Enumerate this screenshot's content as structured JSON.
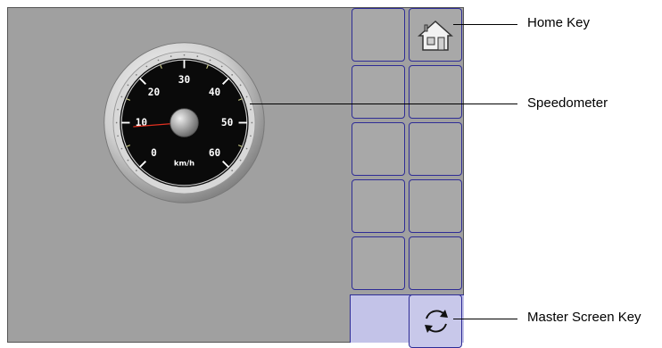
{
  "gauge": {
    "scale_labels": [
      "0",
      "10",
      "20",
      "30",
      "40",
      "50",
      "60"
    ],
    "unit": "km/h",
    "speed_value": 9
  },
  "softkeys": [
    {
      "row": 0,
      "col": 0,
      "icon": ""
    },
    {
      "row": 0,
      "col": 1,
      "icon": "home-icon"
    },
    {
      "row": 1,
      "col": 0,
      "icon": ""
    },
    {
      "row": 1,
      "col": 1,
      "icon": ""
    },
    {
      "row": 2,
      "col": 0,
      "icon": ""
    },
    {
      "row": 2,
      "col": 1,
      "icon": ""
    },
    {
      "row": 3,
      "col": 0,
      "icon": ""
    },
    {
      "row": 3,
      "col": 1,
      "icon": ""
    },
    {
      "row": 4,
      "col": 0,
      "icon": ""
    },
    {
      "row": 4,
      "col": 1,
      "icon": ""
    },
    {
      "row": 5,
      "col": 1,
      "icon": "refresh-icon"
    }
  ],
  "callouts": {
    "home_key": "Home Key",
    "speedometer": "Speedometer",
    "master_screen_key": "Master Screen Key"
  },
  "colors": {
    "screen_bg": "#a0a0a0",
    "softkey_border": "#2e2c96",
    "panel_bg": "#c3c3e8",
    "needle": "#e03020"
  }
}
